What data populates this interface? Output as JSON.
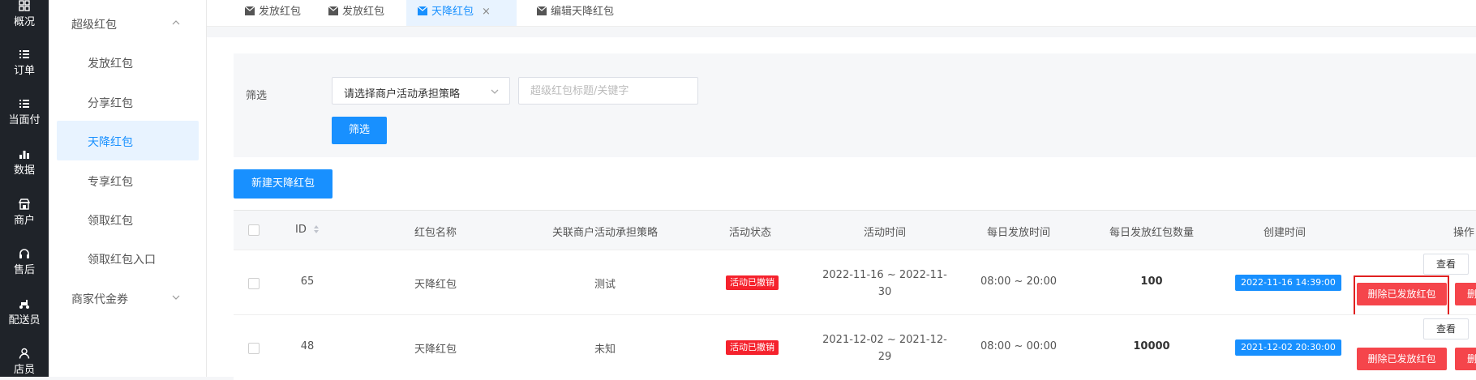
{
  "rail": [
    {
      "label": "概况",
      "icon": "dashboard-icon"
    },
    {
      "label": "订单",
      "icon": "list-icon"
    },
    {
      "label": "当面付",
      "icon": "list-icon"
    },
    {
      "label": "数据",
      "icon": "bar-chart-icon"
    },
    {
      "label": "商户",
      "icon": "store-icon"
    },
    {
      "label": "售后",
      "icon": "headset-icon"
    },
    {
      "label": "配送员",
      "icon": "scooter-icon"
    },
    {
      "label": "店员",
      "icon": "user-icon"
    }
  ],
  "submenu": {
    "group1": "超级红包",
    "items": [
      "发放红包",
      "分享红包",
      "天降红包",
      "专享红包",
      "领取红包",
      "领取红包入口"
    ],
    "active": "天降红包",
    "group2": "商家代金券"
  },
  "tabs": [
    {
      "label": "发放红包",
      "active": false
    },
    {
      "label": "发放红包",
      "active": false
    },
    {
      "label": "天降红包",
      "active": true,
      "close": "×"
    },
    {
      "label": "编辑天降红包",
      "active": false
    }
  ],
  "filter": {
    "label": "筛选",
    "select_value": "请选择商户活动承担策略",
    "input_placeholder": "超级红包标题/关键字",
    "button": "筛选"
  },
  "new_button": "新建天降红包",
  "table": {
    "headers": {
      "id": "ID",
      "name": "红包名称",
      "policy": "关联商户活动承担策略",
      "status": "活动状态",
      "time": "活动时间",
      "daily_time": "每日发放时间",
      "daily_count": "每日发放红包数量",
      "created": "创建时间",
      "actions": "操作"
    },
    "rows": [
      {
        "id": "65",
        "name": "天降红包",
        "policy": "测试",
        "status": "活动已撤销",
        "time_line1": "2022-11-16 ~ 2022-11-",
        "time_line2": "30",
        "daily_time": "08:00 ~ 20:00",
        "daily_count": "100",
        "created": "2022-11-16 14:39:00",
        "view": "查看",
        "delete_sent": "删除已发放红包",
        "delete": "删除"
      },
      {
        "id": "48",
        "name": "天降红包",
        "policy": "未知",
        "status": "活动已撤销",
        "time_line1": "2021-12-02 ~ 2021-12-",
        "time_line2": "29",
        "daily_time": "08:00 ~ 00:00",
        "daily_count": "10000",
        "created": "2021-12-02 20:30:00",
        "view": "查看",
        "delete_sent": "删除已发放红包",
        "delete": "删除"
      }
    ]
  },
  "colors": {
    "primary": "#1890ff",
    "danger": "#f5454b",
    "rail": "#1f2329",
    "highlight": "#e02020"
  }
}
